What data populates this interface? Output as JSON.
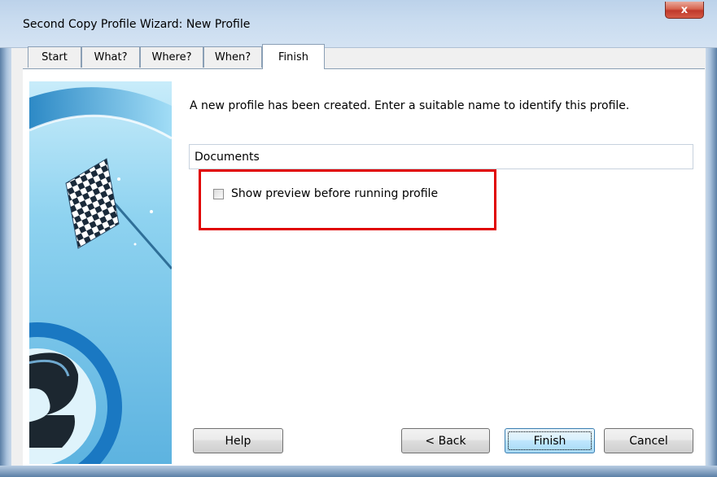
{
  "window": {
    "title": "Second Copy Profile Wizard: New Profile",
    "close_glyph": "x"
  },
  "tabs": [
    {
      "label": "Start",
      "active": false
    },
    {
      "label": "What?",
      "active": false
    },
    {
      "label": "Where?",
      "active": false
    },
    {
      "label": "When?",
      "active": false
    },
    {
      "label": "Finish",
      "active": true
    }
  ],
  "main": {
    "instruction": "A new profile has been created. Enter a suitable name to identify this profile.",
    "profile_name_value": "Documents",
    "show_preview_label": "Show preview before running profile",
    "show_preview_checked": false
  },
  "buttons": {
    "help": "Help",
    "back": "< Back",
    "finish": "Finish",
    "cancel": "Cancel"
  },
  "colors": {
    "highlight": "#e00000",
    "titlebar": "#c8dbef",
    "close_button": "#c0392b"
  },
  "icons": {
    "banner": "checkered-flag-and-logo-banner"
  }
}
